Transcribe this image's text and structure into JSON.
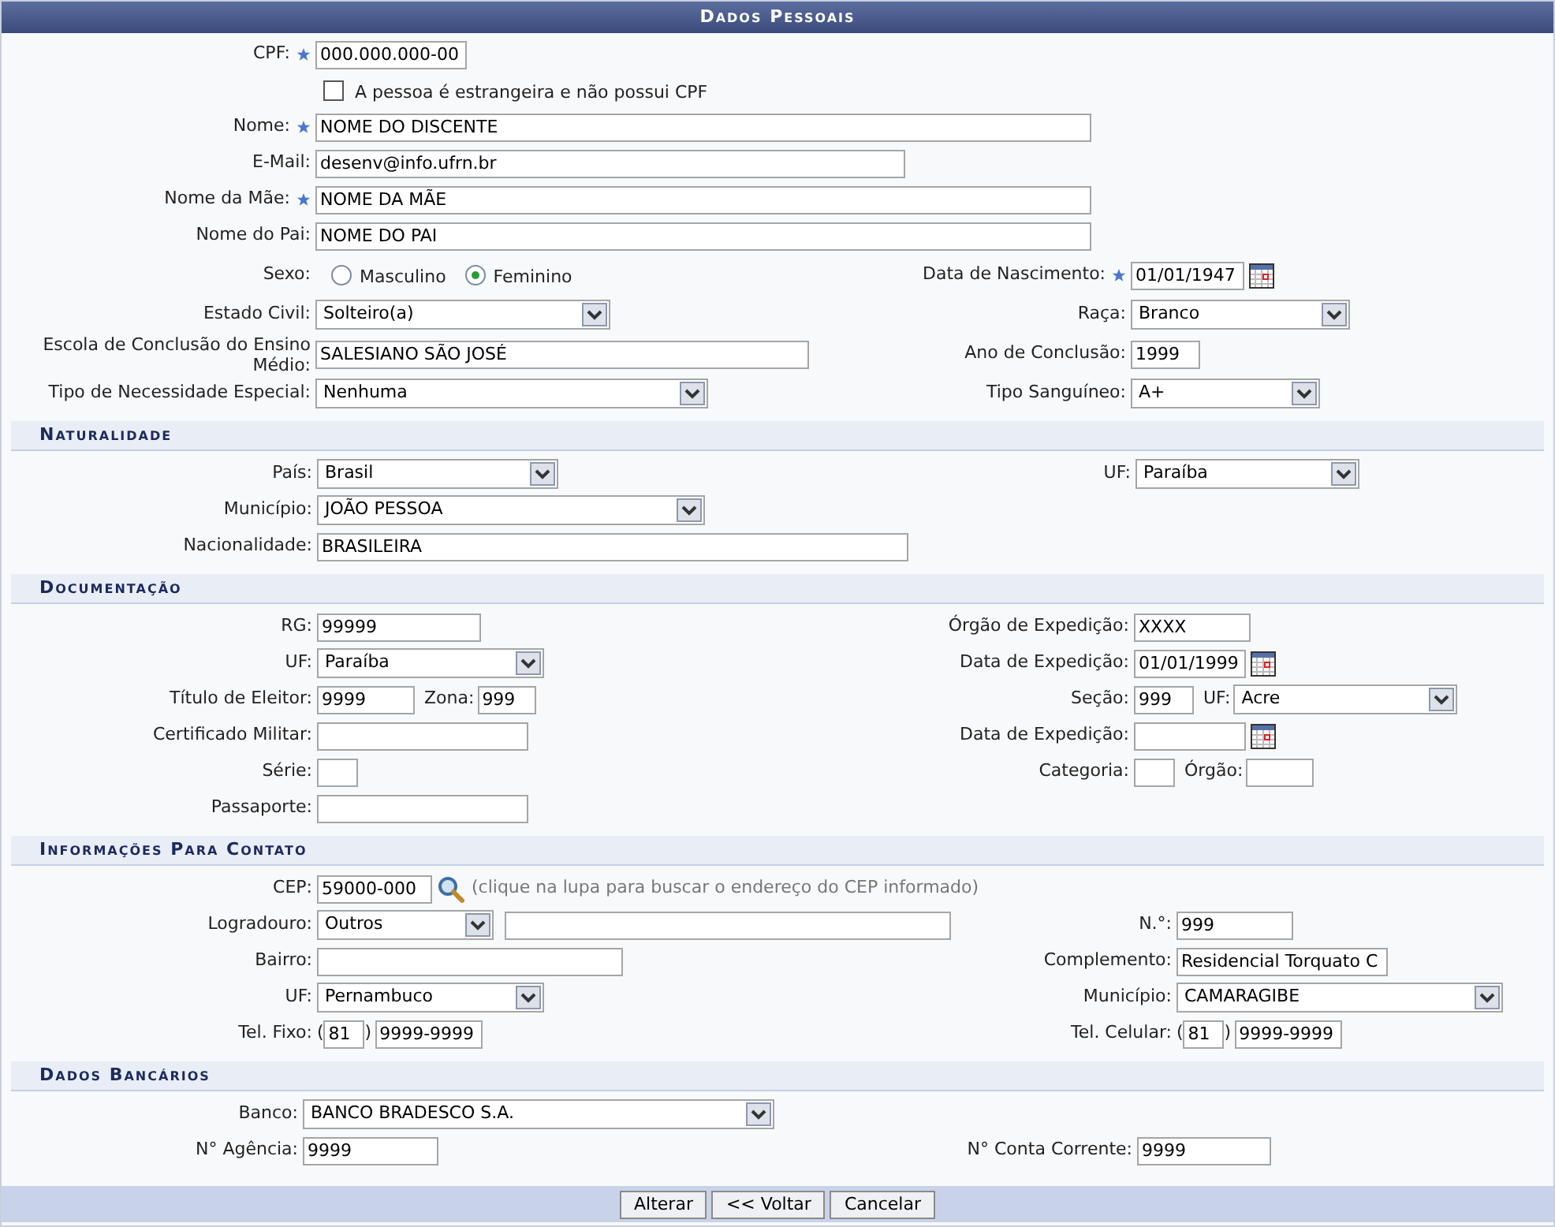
{
  "title": "Dados Pessoais",
  "sections": [
    {
      "rows": [
        {
          "left": [
            {
              "kind": "text",
              "label": "CPF:",
              "required": true,
              "value": "000.000.000-00"
            }
          ]
        },
        {
          "left": [
            {
              "kind": "checkbox",
              "text": "A pessoa é estrangeira e não possui CPF",
              "checked": false
            }
          ]
        },
        {
          "left": [
            {
              "kind": "text",
              "label": "Nome:",
              "required": true,
              "value": "NOME DO DISCENTE"
            }
          ]
        },
        {
          "left": [
            {
              "kind": "text",
              "label": "E-Mail:",
              "value": "desenv@info.ufrn.br"
            }
          ]
        },
        {
          "left": [
            {
              "kind": "text",
              "label": "Nome da Mãe:",
              "required": true,
              "value": "NOME DA MÃE"
            }
          ]
        },
        {
          "left": [
            {
              "kind": "text",
              "label": "Nome do Pai:",
              "value": "NOME DO PAI"
            }
          ]
        },
        {
          "left": [
            {
              "kind": "radio",
              "label": "Sexo:",
              "options": [
                {
                  "label": "Masculino",
                  "selected": false
                },
                {
                  "label": "Feminino",
                  "selected": true
                }
              ]
            }
          ],
          "right": [
            {
              "kind": "date",
              "label": "Data de Nascimento:",
              "required": true,
              "value": "01/01/1947"
            }
          ]
        },
        {
          "left": [
            {
              "kind": "select",
              "label": "Estado Civil:",
              "value": "Solteiro(a)"
            }
          ],
          "right": [
            {
              "kind": "select",
              "label": "Raça:",
              "value": "Branco"
            }
          ]
        },
        {
          "left": [
            {
              "kind": "text",
              "label": "Escola de Conclusão do Ensino Médio:",
              "value": "SALESIANO SÃO JOSÉ"
            }
          ],
          "right": [
            {
              "kind": "text",
              "label": "Ano de Conclusão:",
              "value": "1999"
            }
          ]
        },
        {
          "left": [
            {
              "kind": "select",
              "label": "Tipo de Necessidade Especial:",
              "value": "Nenhuma"
            }
          ],
          "right": [
            {
              "kind": "select",
              "label": "Tipo Sanguíneo:",
              "value": "A+"
            }
          ]
        }
      ]
    },
    {
      "heading": "Naturalidade",
      "rows": [
        {
          "left": [
            {
              "kind": "select",
              "label": "País:",
              "value": "Brasil"
            }
          ],
          "right": [
            {
              "kind": "select",
              "label": "UF:",
              "value": "Paraíba"
            }
          ]
        },
        {
          "left": [
            {
              "kind": "select",
              "label": "Município:",
              "value": "JOÃO PESSOA"
            }
          ]
        },
        {
          "left": [
            {
              "kind": "text",
              "label": "Nacionalidade:",
              "value": "BRASILEIRA"
            }
          ]
        }
      ]
    },
    {
      "heading": "Documentação",
      "rows": [
        {
          "left": [
            {
              "kind": "text",
              "label": "RG:",
              "value": "99999"
            }
          ],
          "right": [
            {
              "kind": "text",
              "label": "Órgão de Expedição:",
              "value": "XXXX"
            }
          ]
        },
        {
          "left": [
            {
              "kind": "select",
              "label": "UF:",
              "value": "Paraíba"
            }
          ],
          "right": [
            {
              "kind": "date",
              "label": "Data de Expedição:",
              "value": "01/01/1999"
            }
          ]
        },
        {
          "left": [
            {
              "kind": "text",
              "label": "Título de Eleitor:",
              "value": "9999"
            },
            {
              "kind": "text",
              "label": "Zona:",
              "value": "999"
            }
          ],
          "right": [
            {
              "kind": "text",
              "label": "Seção:",
              "value": "999"
            },
            {
              "kind": "select",
              "label": "UF:",
              "value": "Acre"
            }
          ]
        },
        {
          "left": [
            {
              "kind": "text",
              "label": "Certificado Militar:"
            }
          ],
          "right": [
            {
              "kind": "date",
              "label": "Data de Expedição:"
            }
          ]
        },
        {
          "left": [
            {
              "kind": "text",
              "label": "Série:"
            }
          ],
          "right": [
            {
              "kind": "text",
              "label": "Categoria:"
            },
            {
              "kind": "text",
              "label": "Órgão:"
            }
          ]
        },
        {
          "left": [
            {
              "kind": "text",
              "label": "Passaporte:"
            }
          ]
        }
      ]
    },
    {
      "heading": "Informações Para Contato",
      "rows": [
        {
          "left": [
            {
              "kind": "cep",
              "label": "CEP:",
              "value": "59000-000",
              "hint": "(clique na lupa para buscar o endereço do CEP informado)"
            }
          ]
        },
        {
          "left": [
            {
              "kind": "select",
              "label": "Logradouro:",
              "value": "Outros"
            },
            {
              "kind": "text"
            }
          ],
          "right": [
            {
              "kind": "text",
              "label": "N.°:",
              "value": "999"
            }
          ]
        },
        {
          "left": [
            {
              "kind": "text",
              "label": "Bairro:"
            }
          ],
          "right": [
            {
              "kind": "text",
              "label": "Complemento:",
              "value": "Residencial Torquato C"
            }
          ]
        },
        {
          "left": [
            {
              "kind": "select",
              "label": "UF:",
              "value": "Pernambuco"
            }
          ],
          "right": [
            {
              "kind": "select",
              "label": "Município:",
              "value": "CAMARAGIBE"
            }
          ]
        },
        {
          "left": [
            {
              "kind": "phone",
              "label": "Tel. Fixo:",
              "open": "(",
              "area": "81",
              "close": ")",
              "number": "9999-9999"
            }
          ],
          "right": [
            {
              "kind": "phone",
              "label": "Tel. Celular:",
              "open": "(",
              "area": "81",
              "close": ")",
              "number": "9999-9999"
            }
          ]
        }
      ]
    },
    {
      "heading": "Dados Bancários",
      "rows": [
        {
          "left": [
            {
              "kind": "select",
              "label": "Banco:",
              "value": "BANCO BRADESCO S.A."
            }
          ]
        },
        {
          "left": [
            {
              "kind": "text",
              "label": "N° Agência:",
              "value": "9999"
            }
          ],
          "right": [
            {
              "kind": "text",
              "label": "N° Conta Corrente:",
              "value": "9999"
            }
          ]
        }
      ]
    }
  ],
  "buttons": [
    "Alterar",
    "<< Voltar",
    "Cancelar"
  ]
}
